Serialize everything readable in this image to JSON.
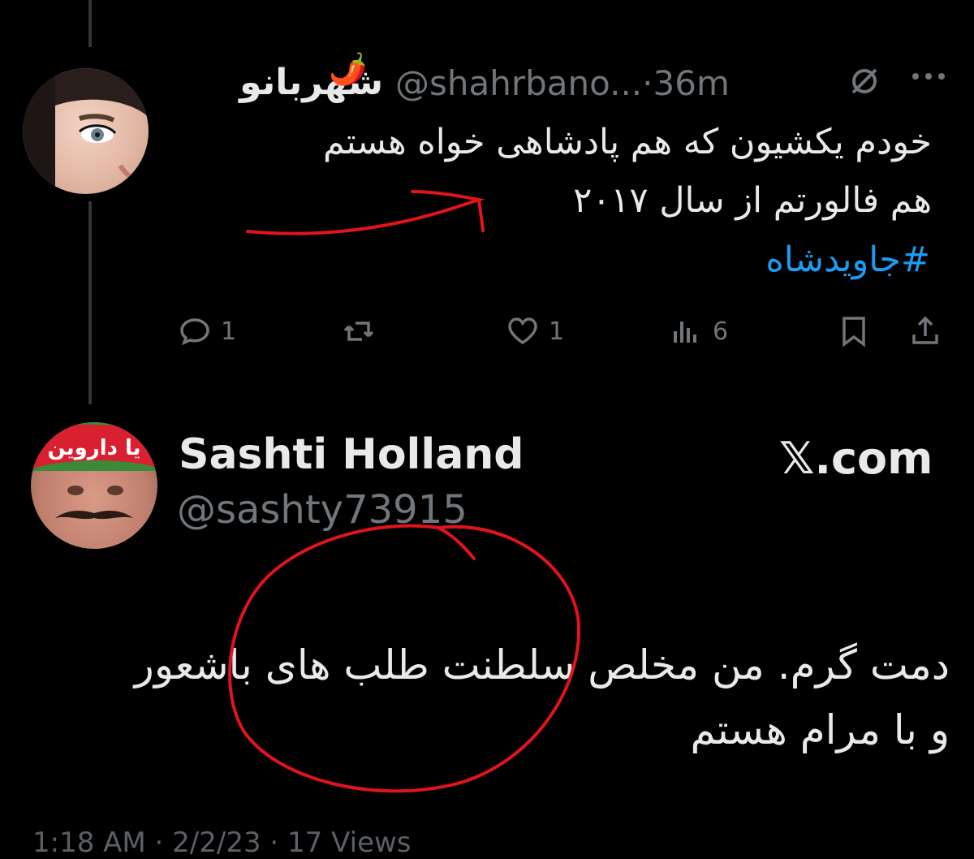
{
  "tweet1": {
    "display_name": "شهربانو",
    "emoji": "🌶️",
    "handle": "@shahrbano...",
    "timestamp": "·36m",
    "icons": [
      "grok-icon",
      "more-icon"
    ],
    "lines": [
      "خودم یکشیون که هم پادشاهی خواه هستم",
      "هم فالورتم از سال ۲۰۱۷"
    ],
    "hashtag": "#جاویدشاه",
    "actions": {
      "replies": "1",
      "likes": "1",
      "views": "6"
    }
  },
  "tweet2": {
    "display_name": "Sashti Holland",
    "handle": "@sashty73915",
    "source": "𝕏.com",
    "lines": [
      "دمت گرم. من مخلص سلطنت طلب های باشعور",
      "و با مرام هستم"
    ],
    "meta_partial": "1:18 AM · 2/2/23 · 17 Views"
  },
  "colors": {
    "background": "#000000",
    "text": "#e7e9ea",
    "muted": "#71767b",
    "link": "#1d9bf0",
    "annotation": "#e0141c"
  }
}
